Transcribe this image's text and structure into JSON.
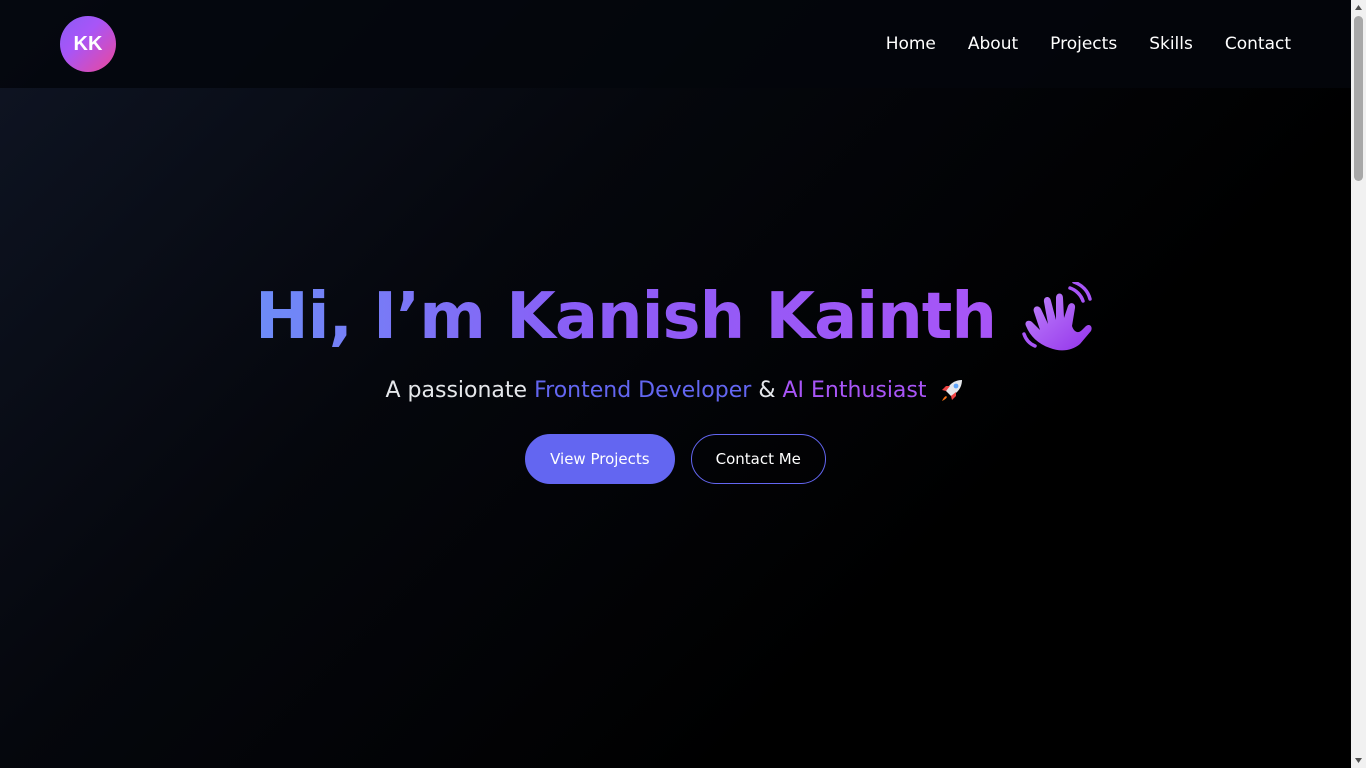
{
  "header": {
    "logo_text": "KK",
    "nav": [
      {
        "label": "Home"
      },
      {
        "label": "About"
      },
      {
        "label": "Projects"
      },
      {
        "label": "Skills"
      },
      {
        "label": "Contact"
      }
    ]
  },
  "hero": {
    "title": "Hi, I’m Kanish Kainth",
    "title_icon": "waving-hand-icon",
    "subtitle_prefix": "A passionate",
    "subtitle_highlight1": "Frontend Developer",
    "subtitle_connector": "&",
    "subtitle_highlight2": "AI Enthusiast",
    "subtitle_icon": "rocket-icon"
  },
  "buttons": {
    "primary_label": "View Projects",
    "secondary_label": "Contact Me"
  },
  "colors": {
    "accent": "#6366f1",
    "purple": "#a855f7",
    "pink": "#ec4899",
    "background": "#000000"
  }
}
